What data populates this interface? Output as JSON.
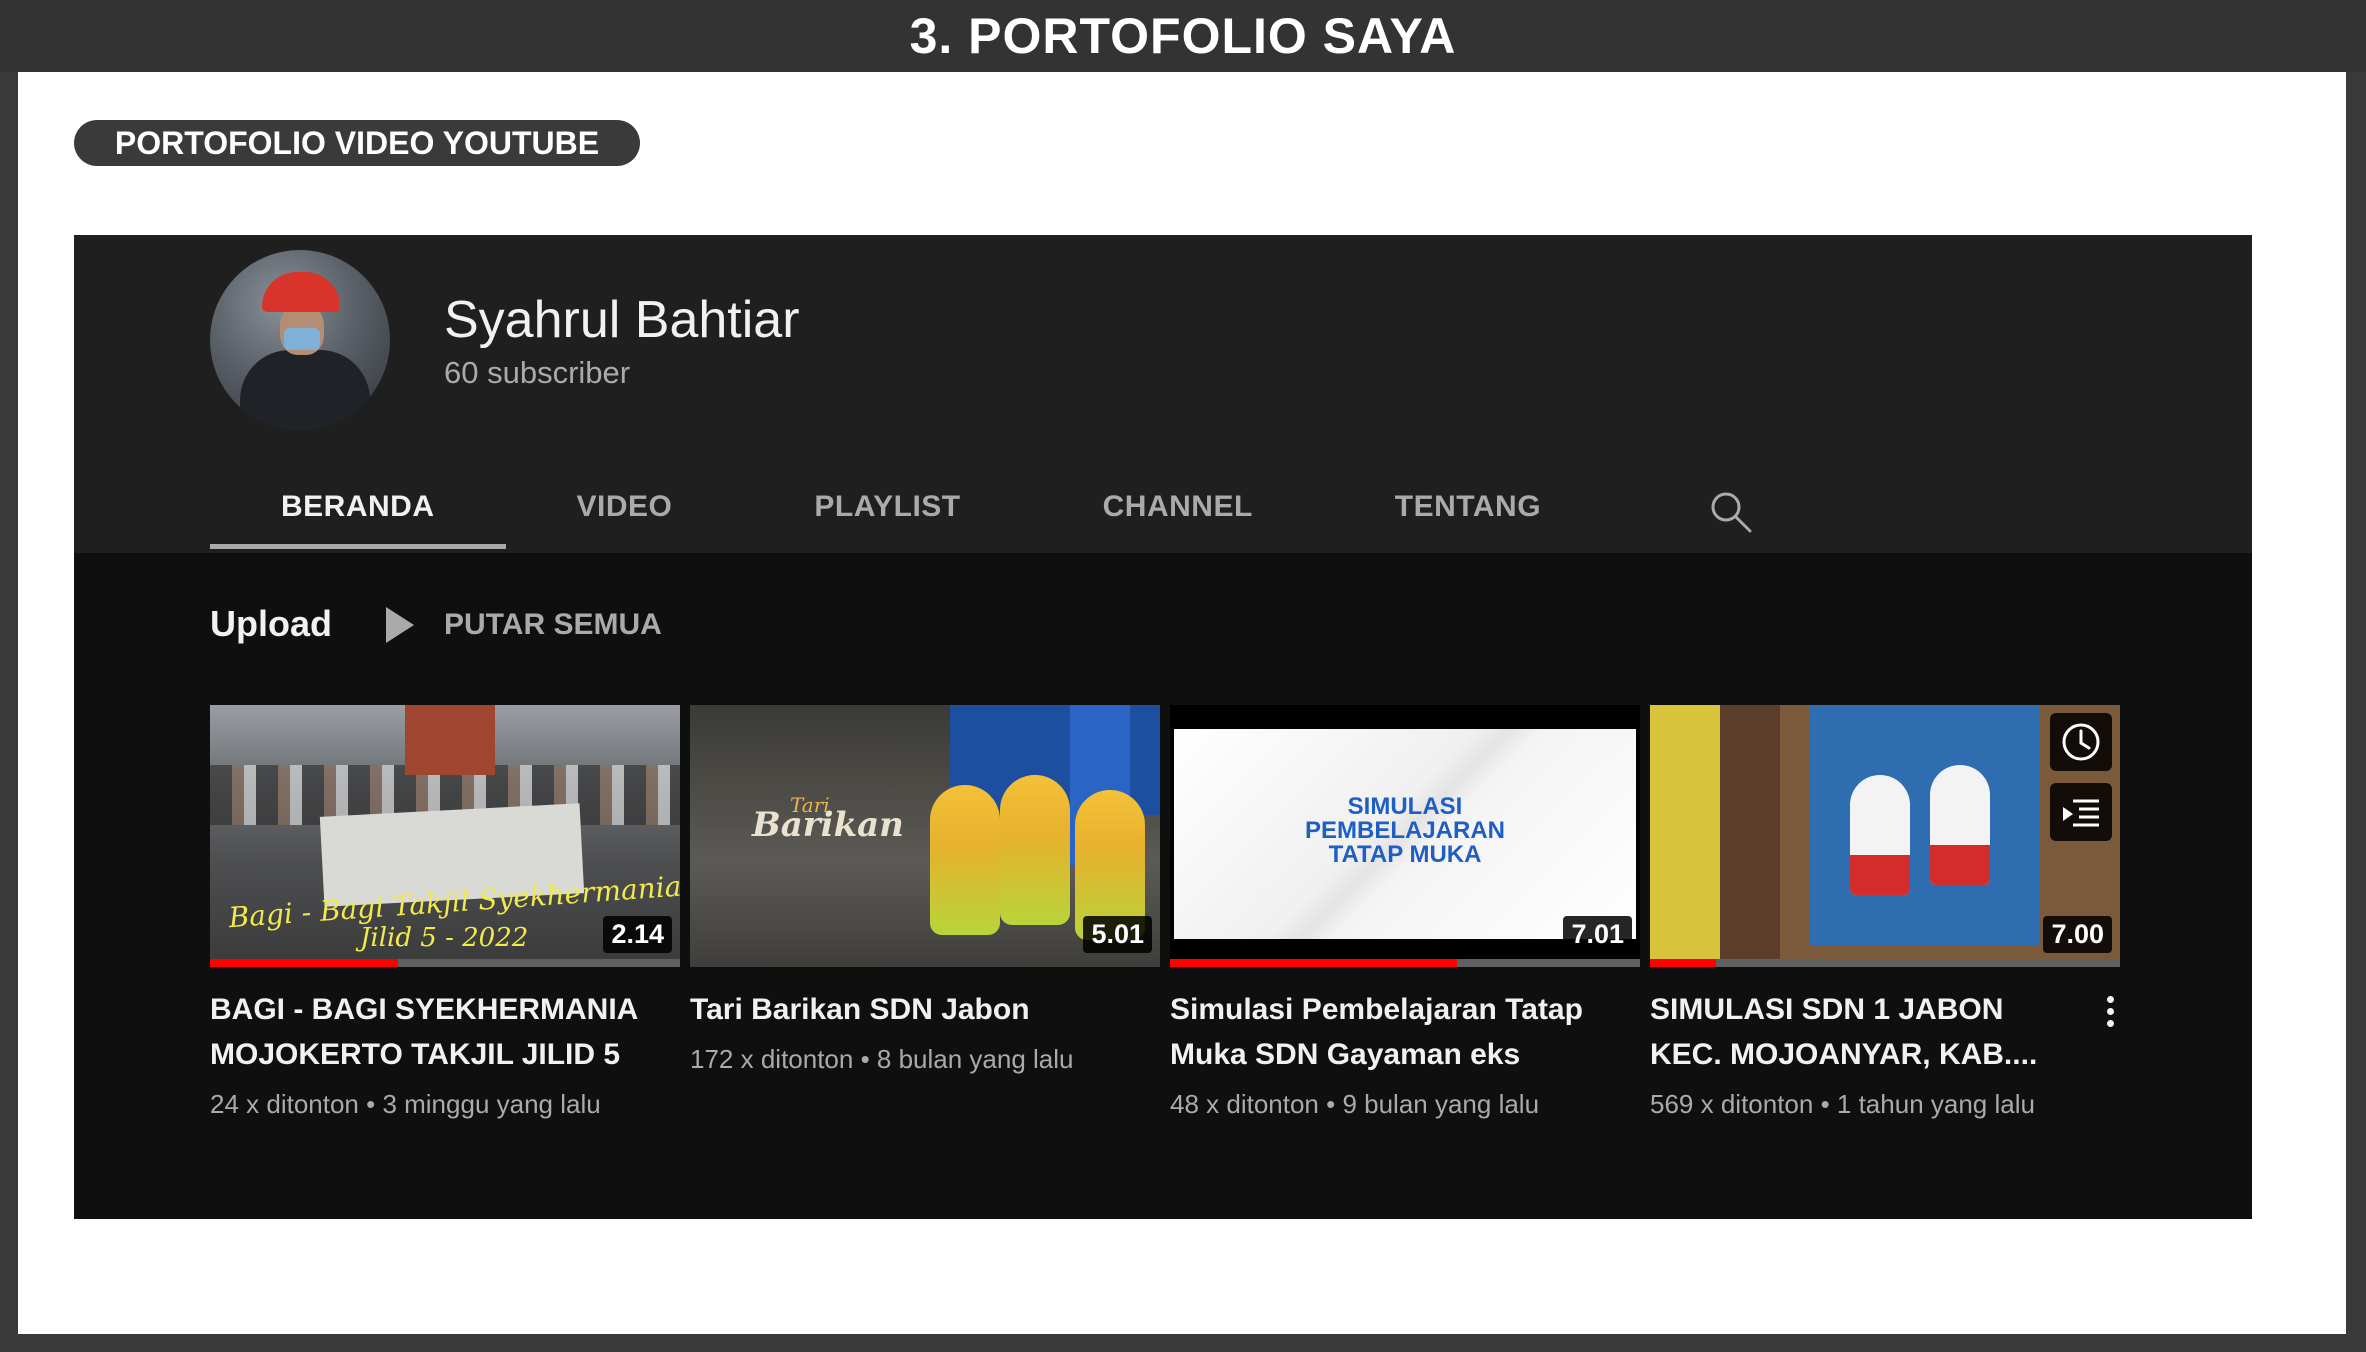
{
  "header": {
    "title": "3. PORTOFOLIO SAYA"
  },
  "section_pill": {
    "label": "PORTOFOLIO VIDEO YOUTUBE"
  },
  "channel": {
    "name": "Syahrul Bahtiar",
    "subscribers": "60 subscriber",
    "tabs": [
      {
        "label": "BERANDA",
        "active": true
      },
      {
        "label": "VIDEO"
      },
      {
        "label": "PLAYLIST"
      },
      {
        "label": "CHANNEL"
      },
      {
        "label": "TENTANG"
      }
    ],
    "search_icon": "search-icon"
  },
  "uploads": {
    "heading": "Upload",
    "play_all_label": "PUTAR SEMUA",
    "videos": [
      {
        "title": "BAGI - BAGI SYEKHERMANIA MOJOKERTO TAKJIL JILID 5",
        "meta": "24 x ditonton • 3 minggu yang lalu",
        "duration": "2.14",
        "watched": 0.4,
        "thumb_text": "Bagi - Bagi Takjil Syekhermania Mojokerto",
        "thumb_text2": "Jilid 5 - 2022"
      },
      {
        "title": "Tari Barikan SDN Jabon",
        "meta": "172 x ditonton • 8 bulan yang lalu",
        "duration": "5.01",
        "watched": 0,
        "thumb_text": "Barikan",
        "thumb_text_small": "Tari"
      },
      {
        "title": "Simulasi Pembelajaran Tatap Muka SDN Gayaman eks",
        "meta": "48 x ditonton • 9 bulan yang lalu",
        "duration": "7.01",
        "watched": 0.61,
        "thumb_text": [
          "SIMULASI",
          "PEMBELAJARAN",
          "TATAP MUKA"
        ]
      },
      {
        "title": "SIMULASI SDN 1 JABON KEC. MOJOANYAR, KAB....",
        "meta": "569 x ditonton • 1 tahun yang lalu",
        "duration": "7.00",
        "watched": 0.14,
        "hover_icons": [
          "clock-icon",
          "add-to-queue-icon"
        ],
        "menu_icon": "more-vert-icon"
      }
    ]
  },
  "colors": {
    "header_bg": "#333333",
    "yt_bg": "#0f0f0f",
    "yt_top_bg": "#1f1f1f",
    "progress_red": "#ff0000"
  }
}
